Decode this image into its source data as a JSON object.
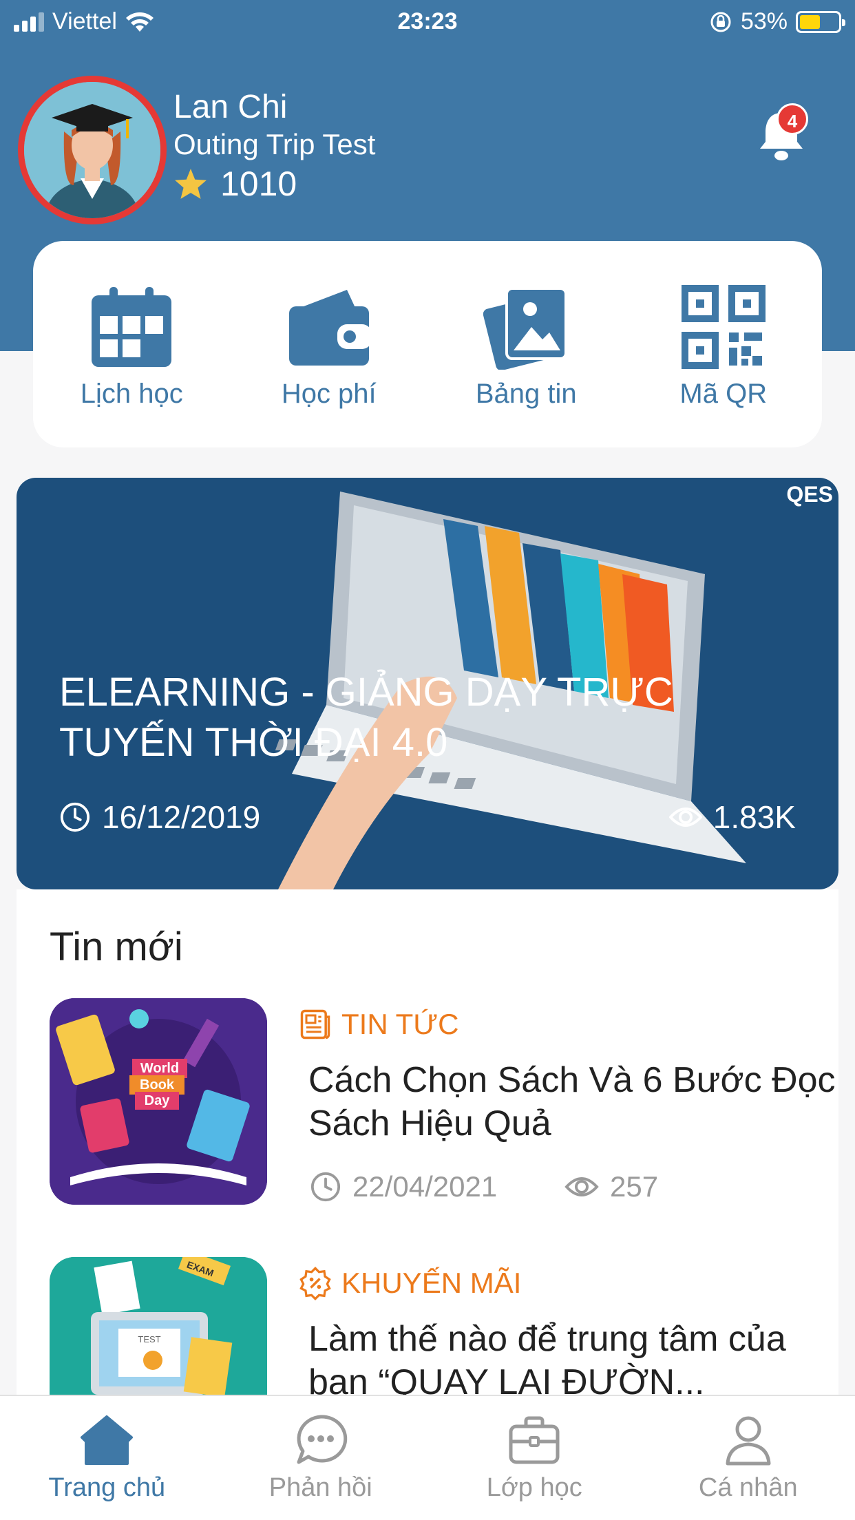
{
  "status_bar": {
    "carrier": "Viettel",
    "time": "23:23",
    "battery": "53%"
  },
  "profile": {
    "name": "Lan Chi",
    "subtitle": "Outing Trip Test",
    "points": "1010"
  },
  "notifications": {
    "count": "4"
  },
  "quick_menu": [
    {
      "label": "Lịch học",
      "icon": "calendar-icon"
    },
    {
      "label": "Học phí",
      "icon": "wallet-icon"
    },
    {
      "label": "Bảng tin",
      "icon": "gallery-icon"
    },
    {
      "label": "Mã QR",
      "icon": "qr-code-icon"
    }
  ],
  "banner": {
    "title": "ELEARNING - GIẢNG DẠY TRỰC TUYẾN THỜI ĐẠI 4.0",
    "date": "16/12/2019",
    "views": "1.83K",
    "logo": "QES"
  },
  "news": {
    "section_title": "Tin mới",
    "items": [
      {
        "category": "TIN TỨC",
        "title": "Cách Chọn Sách Và 6 Bước Đọc Sách Hiệu Quả",
        "date": "22/04/2021",
        "views": "257",
        "thumb_text": [
          "World",
          "Book",
          "Day"
        ]
      },
      {
        "category": "KHUYẾN MÃI",
        "title": "Làm thế nào để trung tâm của bạn “QUAY LẠI ĐƯỜN...",
        "thumb_text": [
          "EXAM",
          "TEST"
        ]
      }
    ]
  },
  "bottom_nav": [
    {
      "label": "Trang chủ",
      "icon": "home-icon",
      "active": true
    },
    {
      "label": "Phản hồi",
      "icon": "chat-icon",
      "active": false
    },
    {
      "label": "Lớp học",
      "icon": "briefcase-icon",
      "active": false
    },
    {
      "label": "Cá nhân",
      "icon": "user-icon",
      "active": false
    }
  ],
  "colors": {
    "primary": "#3f78a6",
    "accent_orange": "#ec7a1c",
    "badge_red": "#e53935",
    "banner_bg": "#1d4f7c"
  }
}
